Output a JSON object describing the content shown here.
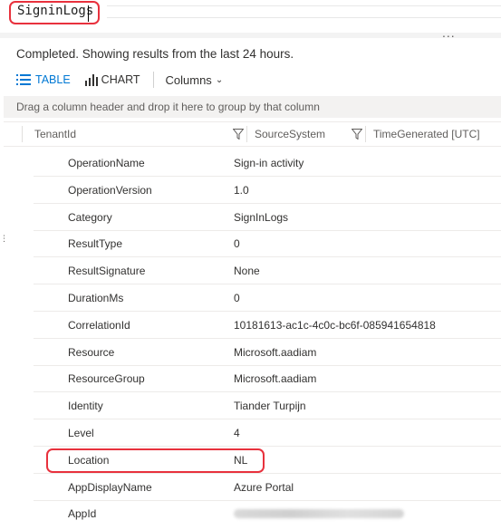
{
  "query": {
    "text": "SigninLogs"
  },
  "results": {
    "status": "Completed. Showing results from the last 24 hours.",
    "more_menu": "...",
    "toolbar": {
      "table_label": "TABLE",
      "chart_label": "CHART",
      "columns_label": "Columns"
    },
    "group_hint": "Drag a column header and drop it here to group by that column",
    "columns": [
      "TenantId",
      "SourceSystem",
      "TimeGenerated [UTC]"
    ],
    "rows": [
      {
        "key": "OperationName",
        "value": "Sign-in activity"
      },
      {
        "key": "OperationVersion",
        "value": "1.0"
      },
      {
        "key": "Category",
        "value": "SignInLogs"
      },
      {
        "key": "ResultType",
        "value": "0"
      },
      {
        "key": "ResultSignature",
        "value": "None"
      },
      {
        "key": "DurationMs",
        "value": "0"
      },
      {
        "key": "CorrelationId",
        "value": "10181613-ac1c-4c0c-bc6f-085941654818"
      },
      {
        "key": "Resource",
        "value": "Microsoft.aadiam"
      },
      {
        "key": "ResourceGroup",
        "value": "Microsoft.aadiam"
      },
      {
        "key": "Identity",
        "value": "Tiander Turpijn"
      },
      {
        "key": "Level",
        "value": "4"
      },
      {
        "key": "Location",
        "value": "NL"
      },
      {
        "key": "AppDisplayName",
        "value": "Azure Portal"
      },
      {
        "key": "AppId",
        "value": ""
      }
    ]
  },
  "colors": {
    "accent": "#0078d4",
    "highlight": "#e8313d"
  }
}
